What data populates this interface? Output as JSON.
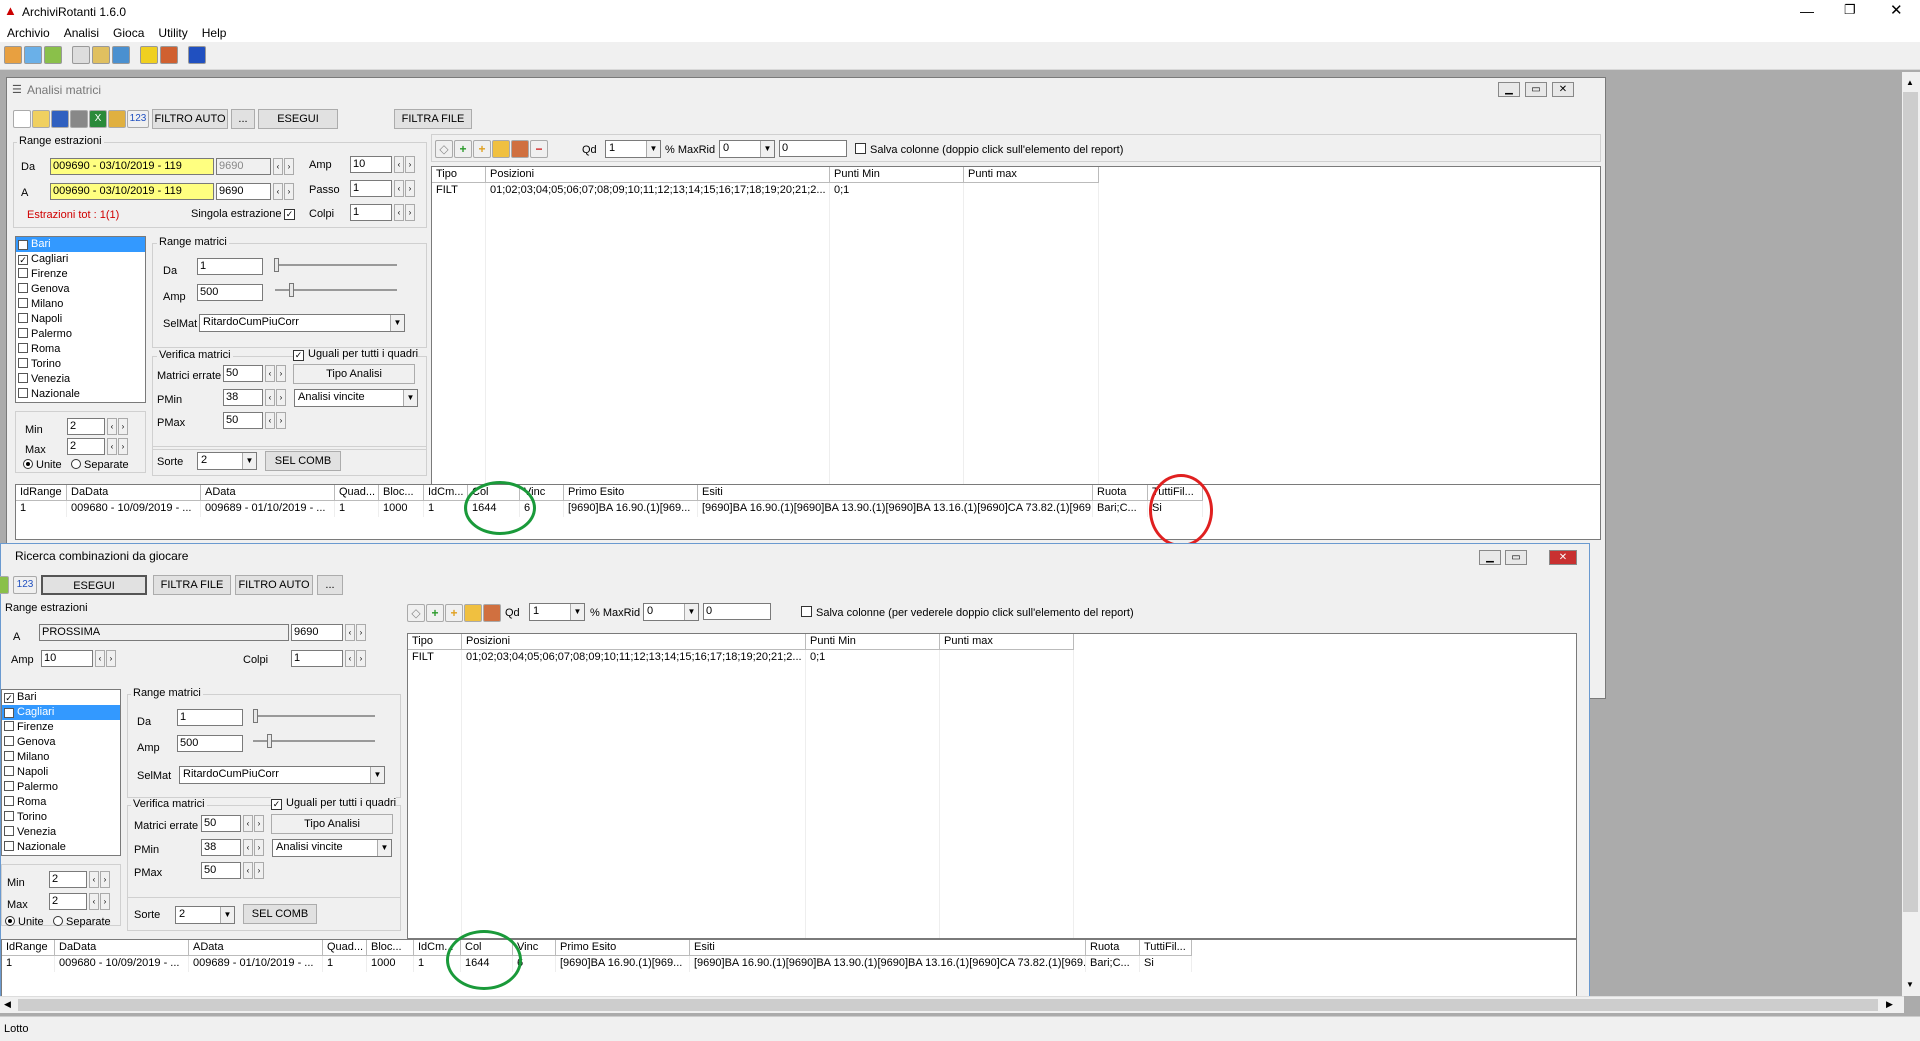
{
  "app": {
    "title": "ArchiviRotanti  1.6.0"
  },
  "menu": [
    "Archivio",
    "Analisi",
    "Gioca",
    "Utility",
    "Help"
  ],
  "win1": {
    "title": "Analisi matrici",
    "toolbar": {
      "filtro_auto": "FILTRO AUTO",
      "more": "...",
      "esegui": "ESEGUI",
      "filtra_file": "FILTRA FILE",
      "n123": "123"
    },
    "range": {
      "title": "Range estrazioni",
      "da_label": "Da",
      "da_value": "009690 - 03/10/2019 - 119",
      "da_num": "9690",
      "a_label": "A",
      "a_value": "009690 - 03/10/2019 - 119",
      "a_num": "9690",
      "amp_label": "Amp",
      "amp_value": "10",
      "passo_label": "Passo",
      "passo_value": "1",
      "colpi_label": "Colpi",
      "colpi_value": "1",
      "tot": "Estrazioni tot : 1(1)",
      "singola": "Singola estrazione"
    },
    "ruote": [
      "Bari",
      "Cagliari",
      "Firenze",
      "Genova",
      "Milano",
      "Napoli",
      "Palermo",
      "Roma",
      "Torino",
      "Venezia",
      "Nazionale"
    ],
    "minmax": {
      "min_label": "Min",
      "min_value": "2",
      "max_label": "Max",
      "max_value": "2",
      "unite": "Unite",
      "separate": "Separate"
    },
    "range_matrici": {
      "title": "Range matrici",
      "da_label": "Da",
      "da_value": "1",
      "amp_label": "Amp",
      "amp_value": "500",
      "selmat_label": "SelMat",
      "selmat_value": "RitardoCumPiuCorr"
    },
    "verifica": {
      "title": "Verifica matrici",
      "uguali": "Uguali per tutti i quadri",
      "errate_label": "Matrici errate",
      "errate_value": "50",
      "tipo": "Tipo Analisi",
      "pmin_label": "PMin",
      "pmin_value": "38",
      "analisi": "Analisi vincite",
      "pmax_label": "PMax",
      "pmax_value": "50"
    },
    "sorte": {
      "label": "Sorte",
      "value": "2",
      "selcomb": "SEL COMB"
    },
    "filters": {
      "qd_label": "Qd",
      "qd_value": "1",
      "maxrid_label": "% MaxRid",
      "maxrid_value": "0",
      "extra": "0",
      "salva": "Salva colonne (doppio click sull'elemento del report)"
    },
    "filter_grid": {
      "headers": [
        "Tipo",
        "Posizioni",
        "Punti Min",
        "Punti max"
      ],
      "row": [
        "FILT",
        "01;02;03;04;05;06;07;08;09;10;11;12;13;14;15;16;17;18;19;20;21;2...",
        "0;1",
        ""
      ]
    },
    "result_grid": {
      "headers": [
        "IdRange",
        "DaData",
        "AData",
        "Quad...",
        "Bloc...",
        "IdCm...",
        "Col",
        "Vinc",
        "Primo Esito",
        "Esiti",
        "Ruota",
        "TuttiFil..."
      ],
      "row": [
        "1",
        "009680 - 10/09/2019 - ...",
        "009689 - 01/10/2019 - ...",
        "1",
        "1000",
        "1",
        "1644",
        "6",
        "[9690]BA 16.90.(1)[969...",
        "[9690]BA 16.90.(1)[9690]BA 13.90.(1)[9690]BA 13.16.(1)[9690]CA 73.82.(1)[969...",
        "Bari;C...",
        "Si"
      ]
    }
  },
  "win2": {
    "title": "Ricerca combinazioni da giocare",
    "toolbar": {
      "n123": "123",
      "esegui": "ESEGUI",
      "filtra_file": "FILTRA FILE",
      "filtro_auto": "FILTRO AUTO",
      "more": "..."
    },
    "range": {
      "title": "Range estrazioni",
      "a_label": "A",
      "a_value": "PROSSIMA",
      "a_num": "9690",
      "amp_label": "Amp",
      "amp_value": "10",
      "colpi_label": "Colpi",
      "colpi_value": "1"
    },
    "ruote": [
      "Bari",
      "Cagliari",
      "Firenze",
      "Genova",
      "Milano",
      "Napoli",
      "Palermo",
      "Roma",
      "Torino",
      "Venezia",
      "Nazionale"
    ],
    "minmax": {
      "min_label": "Min",
      "min_value": "2",
      "max_label": "Max",
      "max_value": "2",
      "unite": "Unite",
      "separate": "Separate"
    },
    "range_matrici": {
      "title": "Range matrici",
      "da_label": "Da",
      "da_value": "1",
      "amp_label": "Amp",
      "amp_value": "500",
      "selmat_label": "SelMat",
      "selmat_value": "RitardoCumPiuCorr"
    },
    "verifica": {
      "title": "Verifica matrici",
      "uguali": "Uguali per tutti i quadri",
      "errate_label": "Matrici errate",
      "errate_value": "50",
      "tipo": "Tipo Analisi",
      "pmin_label": "PMin",
      "pmin_value": "38",
      "analisi": "Analisi vincite",
      "pmax_label": "PMax",
      "pmax_value": "50"
    },
    "sorte": {
      "label": "Sorte",
      "value": "2",
      "selcomb": "SEL COMB"
    },
    "filters": {
      "qd_label": "Qd",
      "qd_value": "1",
      "maxrid_label": "% MaxRid",
      "maxrid_value": "0",
      "extra": "0",
      "salva": "Salva colonne (per vederele doppio click sull'elemento del report)"
    },
    "filter_grid": {
      "headers": [
        "Tipo",
        "Posizioni",
        "Punti Min",
        "Punti max"
      ],
      "row": [
        "FILT",
        "01;02;03;04;05;06;07;08;09;10;11;12;13;14;15;16;17;18;19;20;21;2...",
        "0;1",
        ""
      ]
    },
    "result_grid": {
      "headers": [
        "IdRange",
        "DaData",
        "AData",
        "Quad...",
        "Bloc...",
        "IdCm...",
        "Col",
        "Vinc",
        "Primo Esito",
        "Esiti",
        "Ruota",
        "TuttiFil..."
      ],
      "row": [
        "1",
        "009680 - 10/09/2019 - ...",
        "009689 - 01/10/2019 - ...",
        "1",
        "1000",
        "1",
        "1644",
        "6",
        "[9690]BA 16.90.(1)[969...",
        "[9690]BA 16.90.(1)[9690]BA 13.90.(1)[9690]BA 13.16.(1)[9690]CA 73.82.(1)[969...",
        "Bari;C...",
        "Si"
      ]
    }
  },
  "status": {
    "text": "Lotto"
  },
  "colors": {
    "highlight_green": "#1a9a3a",
    "highlight_red": "#e02020",
    "yellow_field": "#ffff80",
    "selection": "#3399ff"
  }
}
